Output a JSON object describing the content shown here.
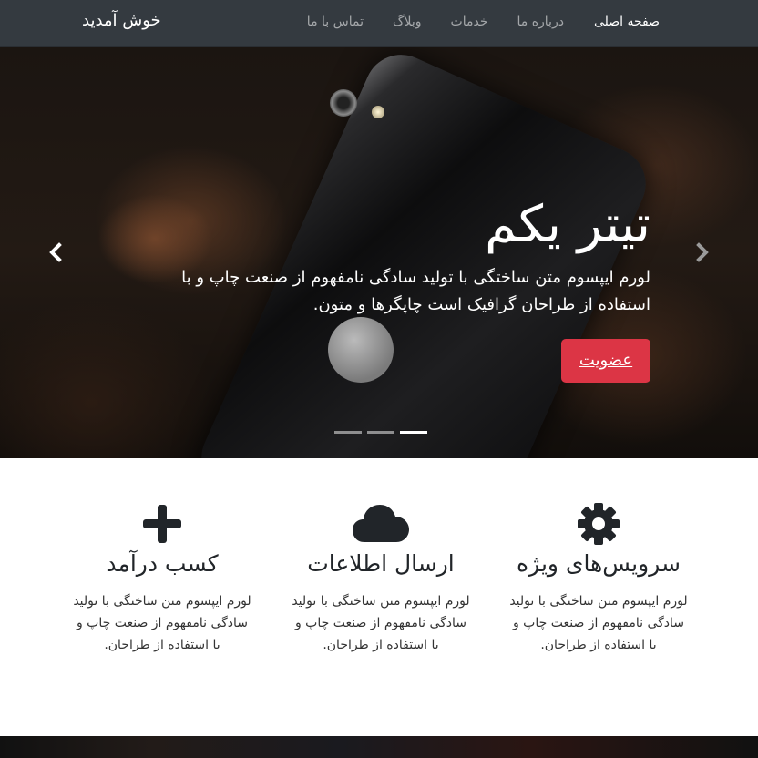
{
  "navbar": {
    "brand": "خوش آمدید",
    "items": [
      {
        "label": "صفحه اصلی",
        "active": true
      },
      {
        "label": "درباره ما"
      },
      {
        "label": "خدمات"
      },
      {
        "label": "وبلاگ"
      },
      {
        "label": "تماس با ما"
      }
    ]
  },
  "hero": {
    "title": "تیتر یکم",
    "text": "لورم ایپسوم متن ساختگی با تولید سادگی نامفهوم از صنعت چاپ و با استفاده از طراحان گرافیک است چاپگرها و متون.",
    "button_label": "عضویت",
    "prev_icon": "chevron-left-icon",
    "next_icon": "chevron-right-icon",
    "slides": 3,
    "active_slide": 3,
    "button_color": "#dc3545"
  },
  "features": [
    {
      "icon": "gear-icon",
      "title": "سرویس‌های ویژه",
      "text": "لورم ایپسوم متن ساختگی با تولید سادگی نامفهوم از صنعت چاپ و با استفاده از طراحان."
    },
    {
      "icon": "cloud-icon",
      "title": "ارسال اطلاعات",
      "text": "لورم ایپسوم متن ساختگی با تولید سادگی نامفهوم از صنعت چاپ و با استفاده از طراحان."
    },
    {
      "icon": "plus-icon",
      "title": "کسب درآمد",
      "text": "لورم ایپسوم متن ساختگی با تولید سادگی نامفهوم از صنعت چاپ و با استفاده از طراحان."
    }
  ]
}
